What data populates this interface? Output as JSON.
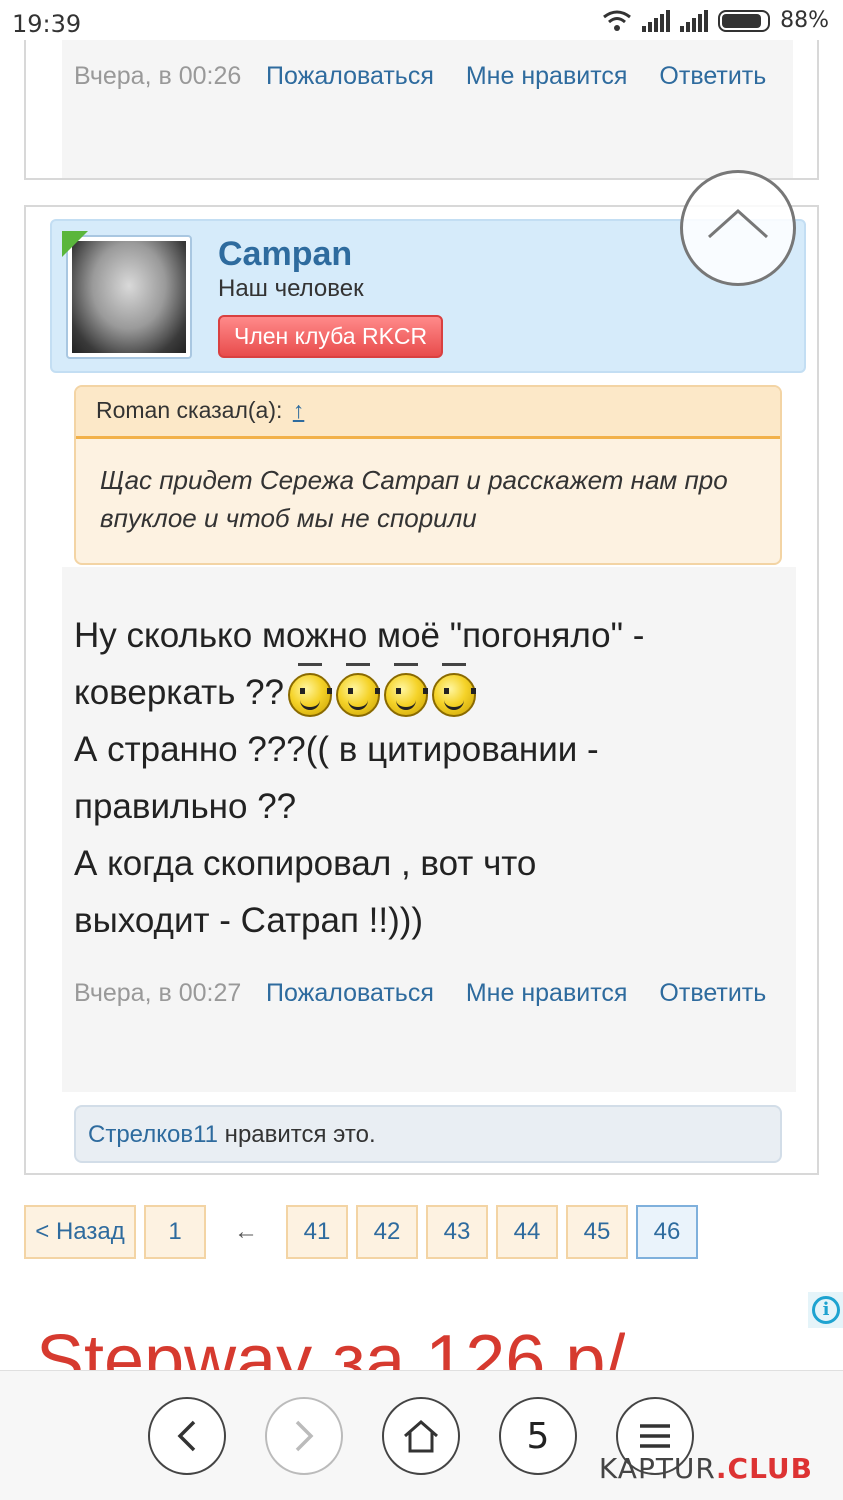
{
  "status_bar": {
    "time": "19:39",
    "battery": "88%"
  },
  "post_prev": {
    "date": "Вчера, в 00:26",
    "report": "Пожаловаться",
    "like": "Мне нравится",
    "reply": "Ответить"
  },
  "post": {
    "username": "Campan",
    "user_title": "Наш человек",
    "user_badge": "Член клуба RKCR",
    "quote": {
      "author": "Roman сказал(а):",
      "jump": "↑",
      "text": "Щас придет Сережа Сатрап и расскажет нам про впуклое и чтоб мы не спорили"
    },
    "message": {
      "line1": "Ну сколько можно моё \"погоняло\" -",
      "line2": "коверкать ??",
      "line3": "А странно ???(( в цитировании -",
      "line4": "правильно ??",
      "line5": "А когда скопировал , вот что",
      "line6": "выходит - Сатрап !!)))"
    },
    "date": "Вчера, в 00:27",
    "report": "Пожаловаться",
    "like": "Мне нравится",
    "reply": "Ответить",
    "likes_user": "Стрелков11",
    "likes_text": " нравится это."
  },
  "pager": {
    "prev": "< Назад",
    "first": "1",
    "sep": "←",
    "pages": [
      "41",
      "42",
      "43",
      "44",
      "45",
      "46"
    ],
    "current": "46"
  },
  "ad": {
    "text": "Stepway за 126 р/"
  },
  "browser": {
    "tabs_count": "5"
  },
  "watermark": {
    "brand": "KAPTUR",
    "suffix": ".CLUB"
  }
}
